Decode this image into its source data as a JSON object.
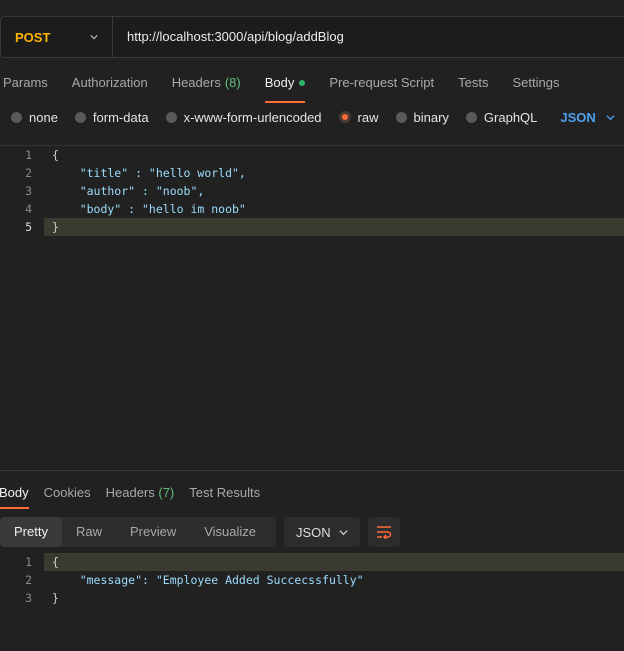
{
  "request": {
    "method": "POST",
    "url": "http://localhost:3000/api/blog/addBlog"
  },
  "request_tabs": {
    "params": "Params",
    "authorization": "Authorization",
    "headers": "Headers",
    "headers_count": "(8)",
    "body": "Body",
    "pre_request": "Pre-request Script",
    "tests": "Tests",
    "settings": "Settings"
  },
  "body_types": {
    "none": "none",
    "form_data": "form-data",
    "urlencoded": "x-www-form-urlencoded",
    "raw": "raw",
    "binary": "binary",
    "graphql": "GraphQL",
    "selected": "raw",
    "language": "JSON"
  },
  "request_body": {
    "lines": [
      {
        "n": "1",
        "text": "{"
      },
      {
        "n": "2",
        "text": "    \"title\" : \"hello world\","
      },
      {
        "n": "3",
        "text": "    \"author\" : \"noob\","
      },
      {
        "n": "4",
        "text": "    \"body\" : \"hello im noob\""
      },
      {
        "n": "5",
        "text": "}"
      }
    ]
  },
  "response_tabs": {
    "body": "Body",
    "cookies": "Cookies",
    "headers": "Headers",
    "headers_count": "(7)",
    "test_results": "Test Results"
  },
  "response_view": {
    "pretty": "Pretty",
    "raw": "Raw",
    "preview": "Preview",
    "visualize": "Visualize",
    "format": "JSON"
  },
  "response_body": {
    "lines": [
      {
        "n": "1",
        "text": "{"
      },
      {
        "n": "2",
        "text": "    \"message\": \"Employee Added Succecssfully\""
      },
      {
        "n": "3",
        "text": "}"
      }
    ]
  },
  "colors": {
    "accent": "#ff6c37",
    "method": "#ffb400",
    "json_label": "#4f9ff0",
    "background": "#212121"
  }
}
